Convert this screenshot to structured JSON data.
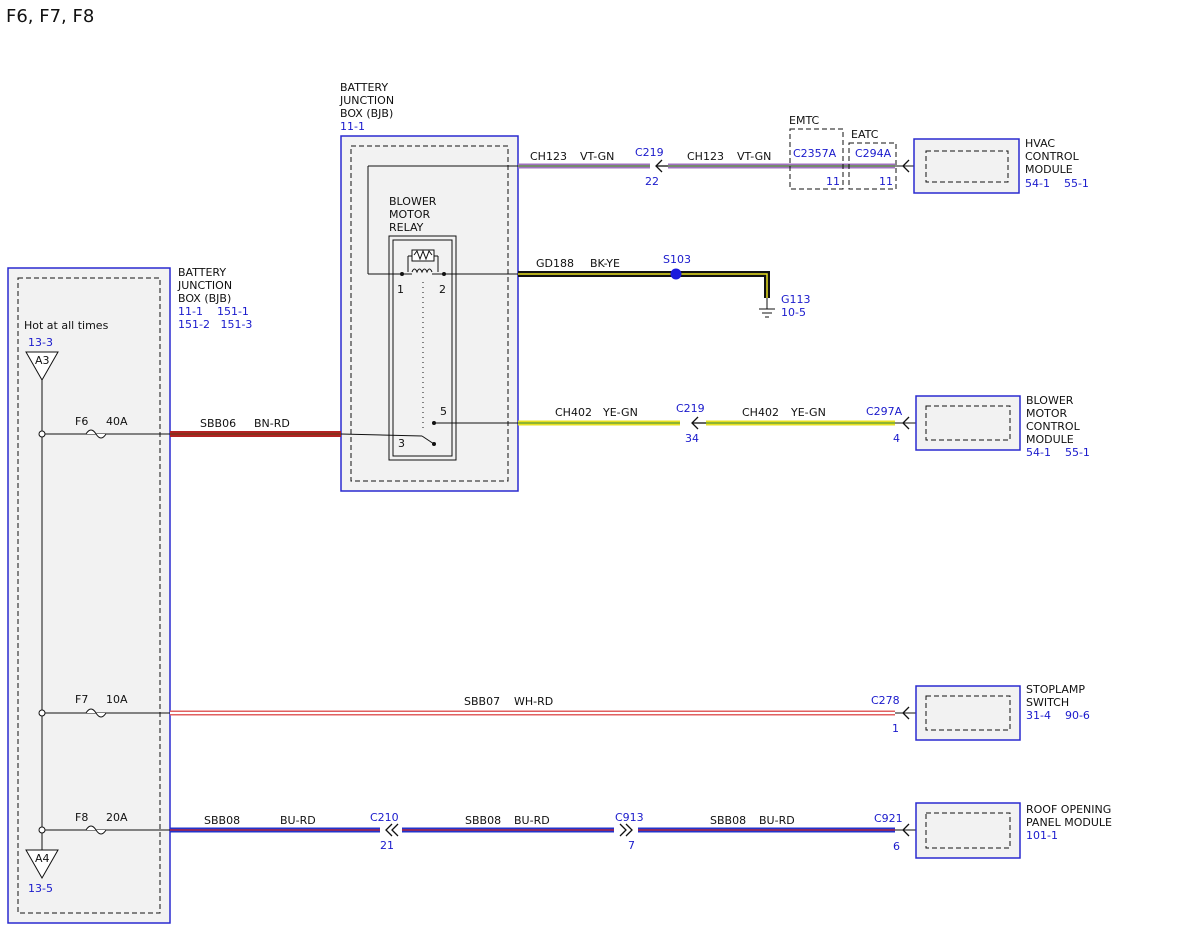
{
  "title": "F6, F7, F8",
  "colors": {
    "ref": "#1a1acc",
    "box_border": "#2a2ad0",
    "bn_rd": "#b22222",
    "bu": "#2233cc",
    "wh_rd_stripe": "#e06060",
    "vt": "#a070c0",
    "bk": "#111111",
    "ye": "#e8e020",
    "gn": "#5a9a3a"
  },
  "bjb_main": {
    "name_lines": [
      "BATTERY",
      "JUNCTION",
      "BOX (BJB)"
    ],
    "refs_lines": [
      "11-1    151-1",
      "151-2   151-3"
    ],
    "hot_label": "Hot at all times",
    "a3": {
      "ref": "13-3",
      "label": "A3"
    },
    "a4": {
      "ref": "13-5",
      "label": "A4"
    },
    "fuses": [
      {
        "name": "F6",
        "rating": "40A"
      },
      {
        "name": "F7",
        "rating": "10A"
      },
      {
        "name": "F8",
        "rating": "20A"
      }
    ]
  },
  "bjb_relay": {
    "name_lines": [
      "BATTERY",
      "JUNCTION",
      "BOX (BJB)"
    ],
    "ref": "11-1",
    "relay_lines": [
      "BLOWER",
      "MOTOR",
      "RELAY"
    ],
    "pins": [
      "1",
      "2",
      "3",
      "5"
    ]
  },
  "wires": {
    "ch123_a": {
      "circuit": "CH123",
      "color": "VT-GN"
    },
    "ch123_b": {
      "circuit": "CH123",
      "color": "VT-GN"
    },
    "gd188": {
      "circuit": "GD188",
      "color": "BK-YE"
    },
    "ch402_a": {
      "circuit": "CH402",
      "color": "YE-GN"
    },
    "ch402_b": {
      "circuit": "CH402",
      "color": "YE-GN"
    },
    "sbb06": {
      "circuit": "SBB06",
      "color": "BN-RD"
    },
    "sbb07": {
      "circuit": "SBB07",
      "color": "WH-RD"
    },
    "sbb08_a": {
      "circuit": "SBB08",
      "color": "BU-RD"
    },
    "sbb08_b": {
      "circuit": "SBB08",
      "color": "BU-RD"
    },
    "sbb08_c": {
      "circuit": "SBB08",
      "color": "BU-RD"
    }
  },
  "connectors": {
    "c219_top": {
      "name": "C219",
      "pin": "22"
    },
    "c2357a": {
      "name": "C2357A",
      "pin": "11"
    },
    "c294a": {
      "name": "C294A",
      "pin": "11"
    },
    "c219_mid": {
      "name": "C219",
      "pin": "34"
    },
    "c297a": {
      "name": "C297A",
      "pin": "4"
    },
    "c278": {
      "name": "C278",
      "pin": "1"
    },
    "c210": {
      "name": "C210",
      "pin": "21"
    },
    "c913": {
      "name": "C913",
      "pin": "7"
    },
    "c921": {
      "name": "C921",
      "pin": "6"
    }
  },
  "splice": {
    "name": "S103"
  },
  "ground": {
    "name": "G113",
    "ref": "10-5"
  },
  "variants": {
    "emtc": "EMTC",
    "eatc": "EATC"
  },
  "modules": {
    "hvac": {
      "lines": [
        "HVAC",
        "CONTROL",
        "MODULE"
      ],
      "refs": "54-1    55-1"
    },
    "blower": {
      "lines": [
        "BLOWER",
        "MOTOR",
        "CONTROL",
        "MODULE"
      ],
      "refs": "54-1    55-1"
    },
    "stoplamp": {
      "lines": [
        "STOPLAMP",
        "SWITCH"
      ],
      "refs": "31-4    90-6"
    },
    "roof": {
      "lines": [
        "ROOF OPENING",
        "PANEL MODULE"
      ],
      "refs": "101-1"
    }
  }
}
